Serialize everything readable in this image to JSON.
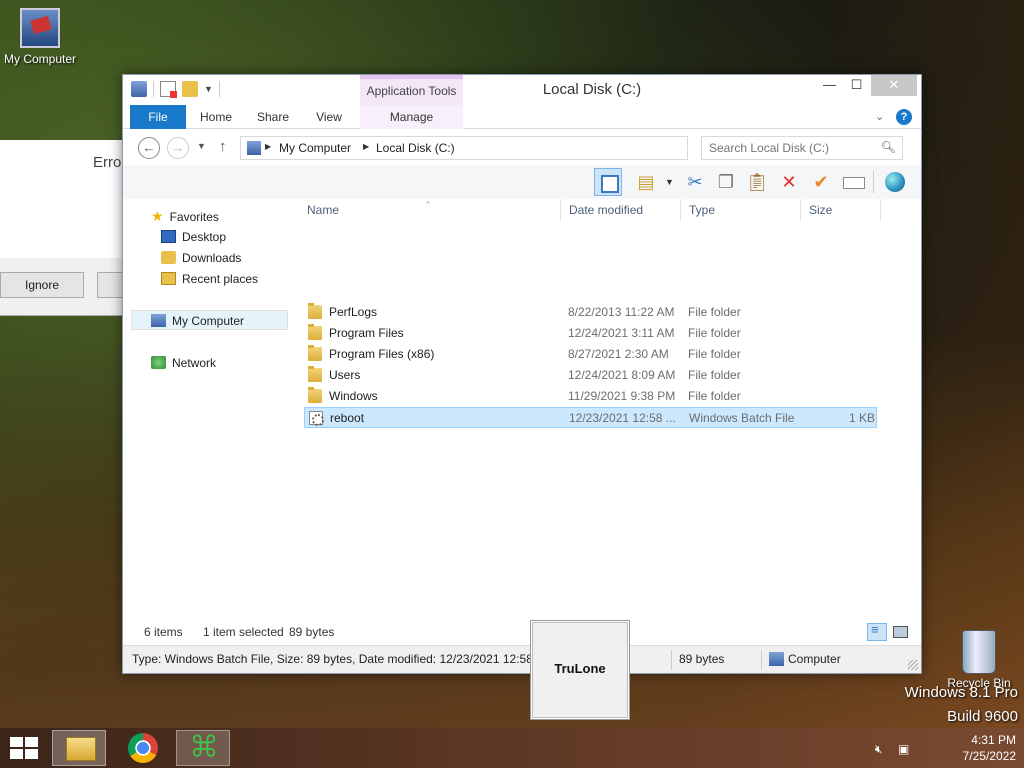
{
  "desktop": {
    "my_computer_label": "My Computer",
    "recycle_bin_label": "Recycle Bin",
    "watermark_line1": "Windows 8.1 Pro",
    "watermark_line2": "Build 9600"
  },
  "error_dialog": {
    "title_fragment": "Error",
    "ignore_label": "Ignore"
  },
  "window": {
    "title": "Local Disk (C:)",
    "contextual_group": "Application Tools",
    "ribbon_tabs": {
      "file": "File",
      "home": "Home",
      "share": "Share",
      "view": "View",
      "manage": "Manage"
    },
    "controls": {
      "minimize": "—",
      "maximize": "☐",
      "close": "✕"
    }
  },
  "address": {
    "crumbs": [
      "My Computer",
      "Local Disk (C:)"
    ],
    "search_placeholder": "Search Local Disk (C:)"
  },
  "nav_pane": {
    "favorites": "Favorites",
    "desktop": "Desktop",
    "downloads": "Downloads",
    "recent_places": "Recent places",
    "my_computer": "My Computer",
    "network": "Network"
  },
  "columns": {
    "name": "Name",
    "date_modified": "Date modified",
    "type": "Type",
    "size": "Size"
  },
  "files": [
    {
      "name": "PerfLogs",
      "date": "8/22/2013 11:22 AM",
      "type": "File folder",
      "size": ""
    },
    {
      "name": "Program Files",
      "date": "12/24/2021 3:11 AM",
      "type": "File folder",
      "size": ""
    },
    {
      "name": "Program Files (x86)",
      "date": "8/27/2021 2:30 AM",
      "type": "File folder",
      "size": ""
    },
    {
      "name": "Users",
      "date": "12/24/2021 8:09 AM",
      "type": "File folder",
      "size": ""
    },
    {
      "name": "Windows",
      "date": "11/29/2021 9:38 PM",
      "type": "File folder",
      "size": ""
    },
    {
      "name": "reboot",
      "date": "12/23/2021 12:58 ...",
      "type": "Windows Batch File",
      "size": "1 KB"
    }
  ],
  "status": {
    "item_count": "6 items",
    "selected": "1 item selected",
    "selected_size": "89 bytes",
    "details": "Type: Windows Batch File, Size: 89 bytes, Date modified: 12/23/2021 12:58 PM",
    "size_cell": "89 bytes",
    "location": "Computer"
  },
  "trulone_popup": {
    "label": "TruLone"
  },
  "taskbar": {
    "time": "4:31 PM",
    "date": "7/25/2022"
  }
}
